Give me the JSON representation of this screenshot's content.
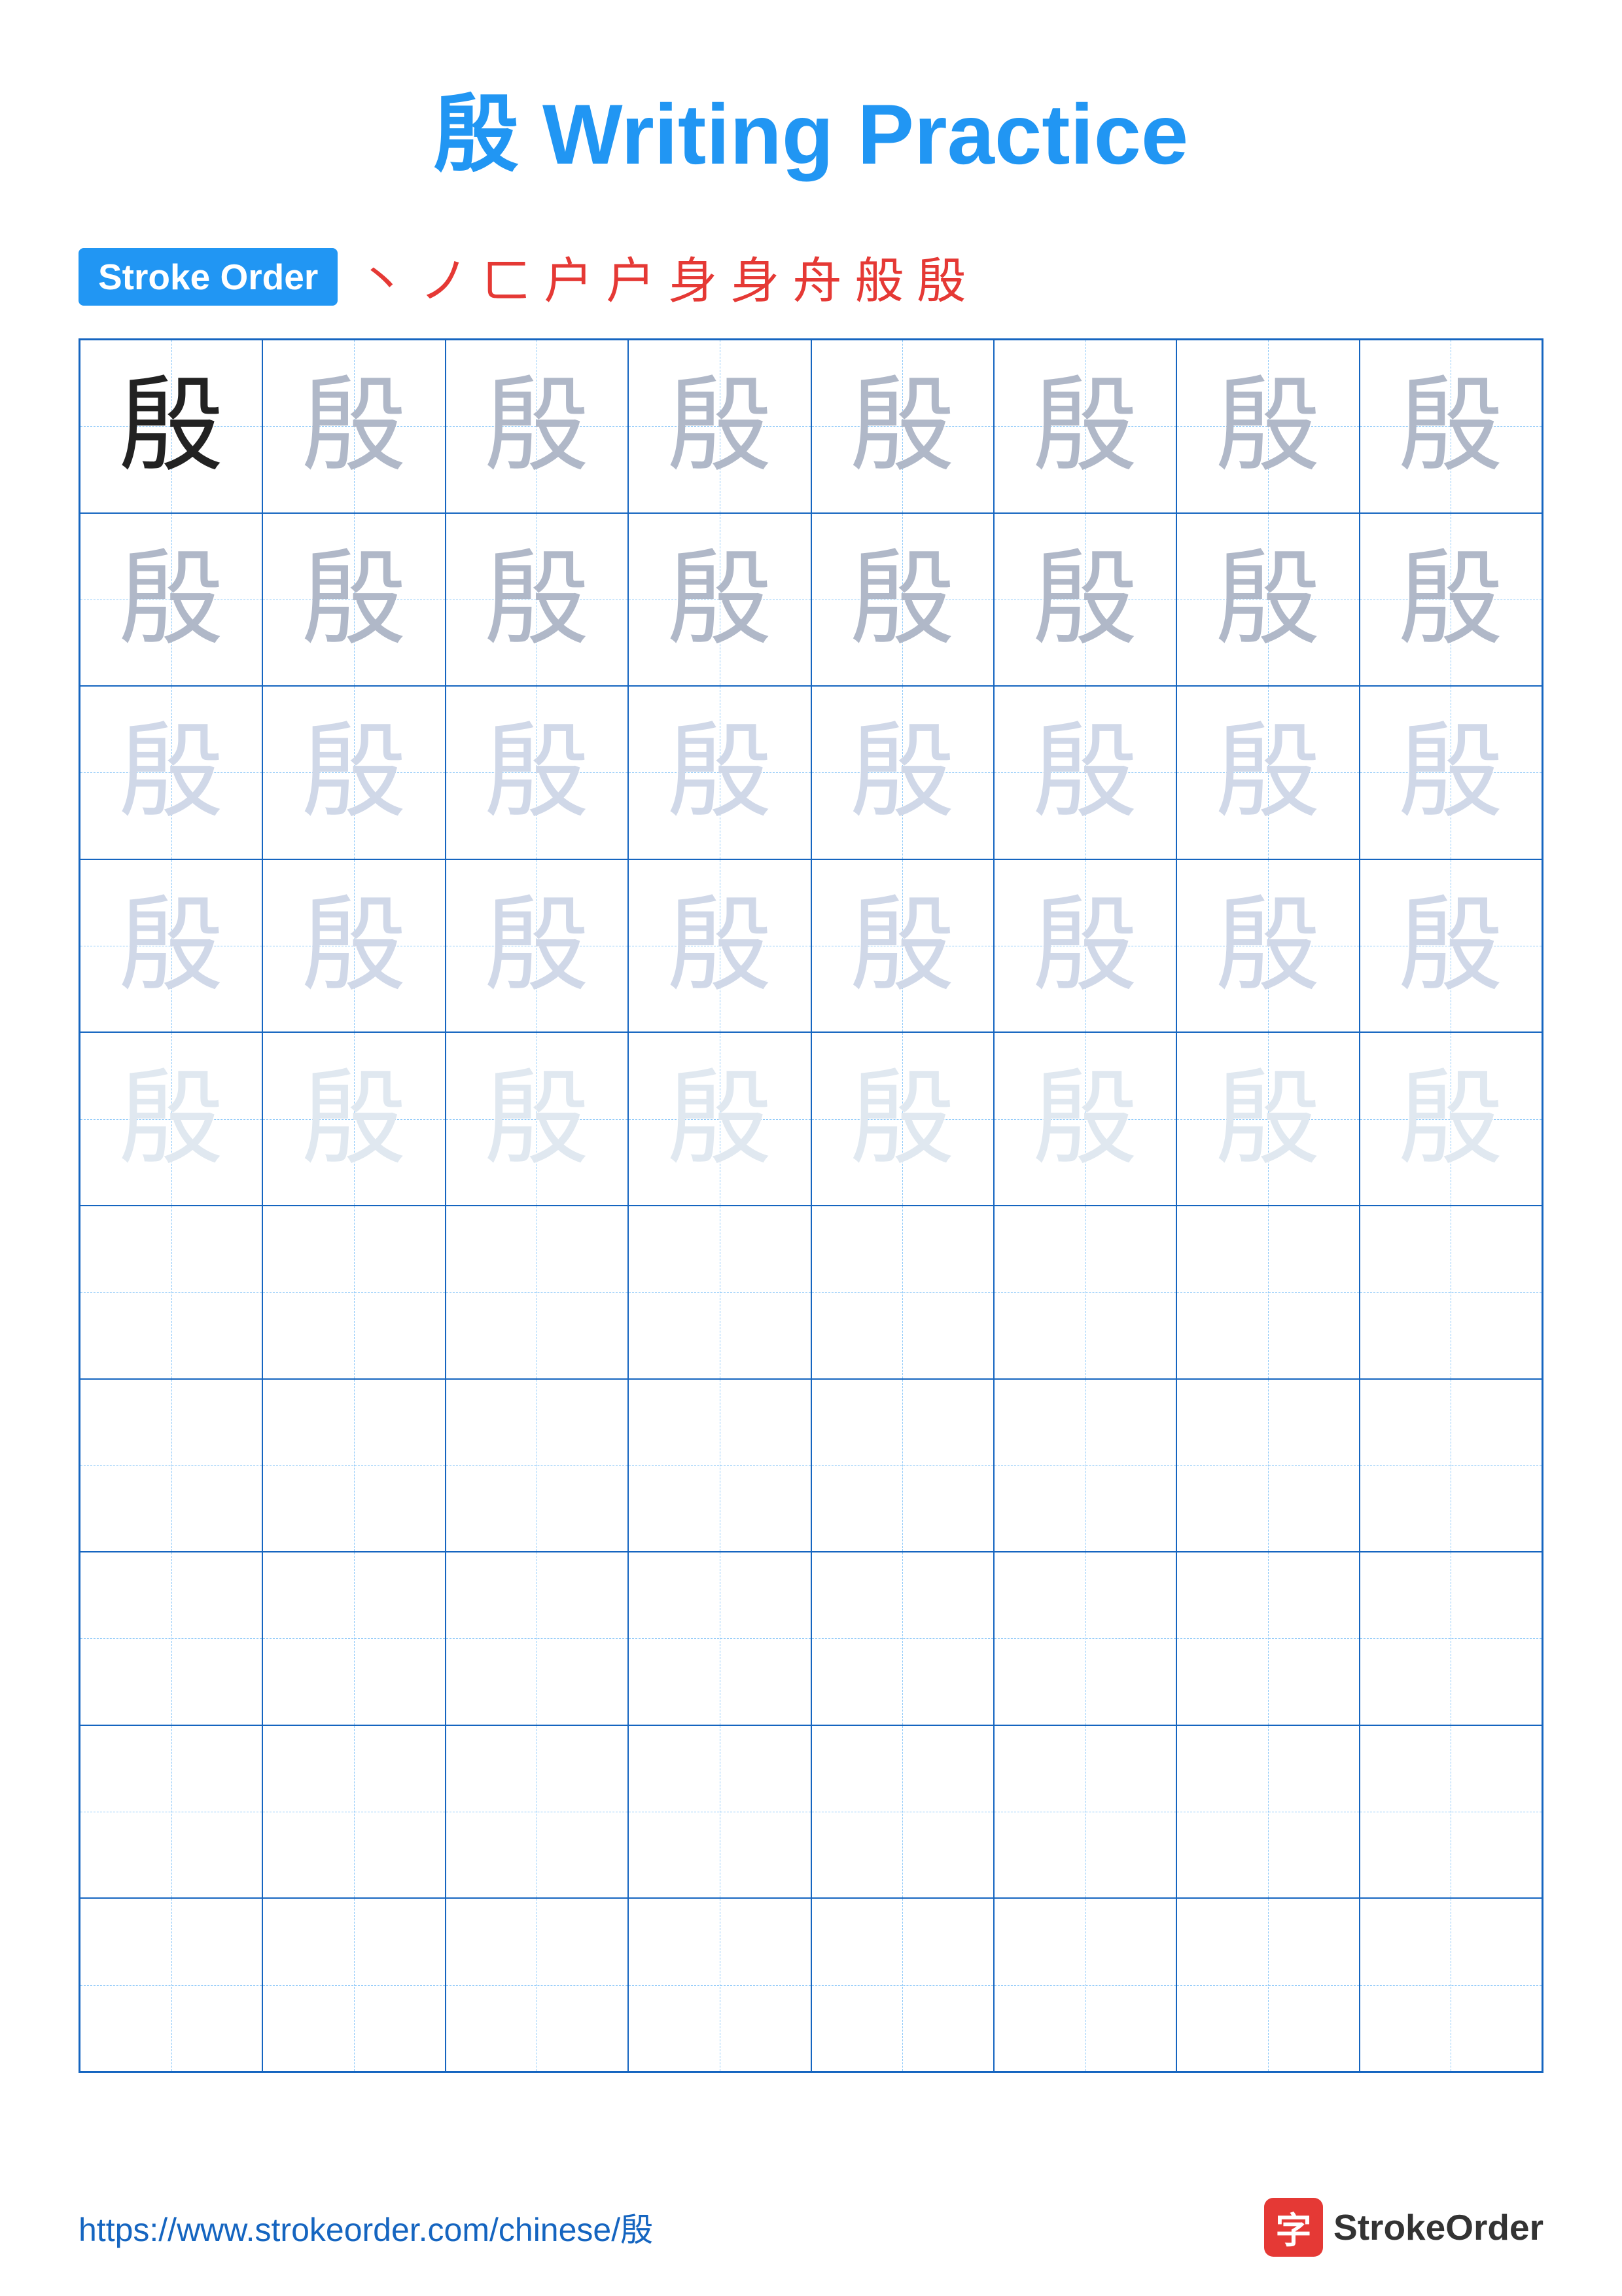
{
  "title": "殷 Writing Practice",
  "stroke_order_badge": "Stroke Order",
  "stroke_sequence": [
    "丶",
    "ノ",
    "ㄈ",
    "户",
    "户",
    "身",
    "身",
    "舟",
    "般",
    "殷"
  ],
  "character": "殷",
  "grid": {
    "cols": 8,
    "rows": 10,
    "cells": [
      {
        "row": 0,
        "col": 0,
        "shade": "dark"
      },
      {
        "row": 0,
        "col": 1,
        "shade": "medium"
      },
      {
        "row": 0,
        "col": 2,
        "shade": "medium"
      },
      {
        "row": 0,
        "col": 3,
        "shade": "medium"
      },
      {
        "row": 0,
        "col": 4,
        "shade": "medium"
      },
      {
        "row": 0,
        "col": 5,
        "shade": "medium"
      },
      {
        "row": 0,
        "col": 6,
        "shade": "medium"
      },
      {
        "row": 0,
        "col": 7,
        "shade": "medium"
      },
      {
        "row": 1,
        "col": 0,
        "shade": "medium"
      },
      {
        "row": 1,
        "col": 1,
        "shade": "medium"
      },
      {
        "row": 1,
        "col": 2,
        "shade": "medium"
      },
      {
        "row": 1,
        "col": 3,
        "shade": "medium"
      },
      {
        "row": 1,
        "col": 4,
        "shade": "medium"
      },
      {
        "row": 1,
        "col": 5,
        "shade": "medium"
      },
      {
        "row": 1,
        "col": 6,
        "shade": "medium"
      },
      {
        "row": 1,
        "col": 7,
        "shade": "medium"
      },
      {
        "row": 2,
        "col": 0,
        "shade": "light"
      },
      {
        "row": 2,
        "col": 1,
        "shade": "light"
      },
      {
        "row": 2,
        "col": 2,
        "shade": "light"
      },
      {
        "row": 2,
        "col": 3,
        "shade": "light"
      },
      {
        "row": 2,
        "col": 4,
        "shade": "light"
      },
      {
        "row": 2,
        "col": 5,
        "shade": "light"
      },
      {
        "row": 2,
        "col": 6,
        "shade": "light"
      },
      {
        "row": 2,
        "col": 7,
        "shade": "light"
      },
      {
        "row": 3,
        "col": 0,
        "shade": "light"
      },
      {
        "row": 3,
        "col": 1,
        "shade": "light"
      },
      {
        "row": 3,
        "col": 2,
        "shade": "light"
      },
      {
        "row": 3,
        "col": 3,
        "shade": "light"
      },
      {
        "row": 3,
        "col": 4,
        "shade": "light"
      },
      {
        "row": 3,
        "col": 5,
        "shade": "light"
      },
      {
        "row": 3,
        "col": 6,
        "shade": "light"
      },
      {
        "row": 3,
        "col": 7,
        "shade": "light"
      },
      {
        "row": 4,
        "col": 0,
        "shade": "very-light"
      },
      {
        "row": 4,
        "col": 1,
        "shade": "very-light"
      },
      {
        "row": 4,
        "col": 2,
        "shade": "very-light"
      },
      {
        "row": 4,
        "col": 3,
        "shade": "very-light"
      },
      {
        "row": 4,
        "col": 4,
        "shade": "very-light"
      },
      {
        "row": 4,
        "col": 5,
        "shade": "very-light"
      },
      {
        "row": 4,
        "col": 6,
        "shade": "very-light"
      },
      {
        "row": 4,
        "col": 7,
        "shade": "very-light"
      },
      {
        "row": 5,
        "col": 0,
        "shade": "empty"
      },
      {
        "row": 5,
        "col": 1,
        "shade": "empty"
      },
      {
        "row": 5,
        "col": 2,
        "shade": "empty"
      },
      {
        "row": 5,
        "col": 3,
        "shade": "empty"
      },
      {
        "row": 5,
        "col": 4,
        "shade": "empty"
      },
      {
        "row": 5,
        "col": 5,
        "shade": "empty"
      },
      {
        "row": 5,
        "col": 6,
        "shade": "empty"
      },
      {
        "row": 5,
        "col": 7,
        "shade": "empty"
      },
      {
        "row": 6,
        "col": 0,
        "shade": "empty"
      },
      {
        "row": 6,
        "col": 1,
        "shade": "empty"
      },
      {
        "row": 6,
        "col": 2,
        "shade": "empty"
      },
      {
        "row": 6,
        "col": 3,
        "shade": "empty"
      },
      {
        "row": 6,
        "col": 4,
        "shade": "empty"
      },
      {
        "row": 6,
        "col": 5,
        "shade": "empty"
      },
      {
        "row": 6,
        "col": 6,
        "shade": "empty"
      },
      {
        "row": 6,
        "col": 7,
        "shade": "empty"
      },
      {
        "row": 7,
        "col": 0,
        "shade": "empty"
      },
      {
        "row": 7,
        "col": 1,
        "shade": "empty"
      },
      {
        "row": 7,
        "col": 2,
        "shade": "empty"
      },
      {
        "row": 7,
        "col": 3,
        "shade": "empty"
      },
      {
        "row": 7,
        "col": 4,
        "shade": "empty"
      },
      {
        "row": 7,
        "col": 5,
        "shade": "empty"
      },
      {
        "row": 7,
        "col": 6,
        "shade": "empty"
      },
      {
        "row": 7,
        "col": 7,
        "shade": "empty"
      },
      {
        "row": 8,
        "col": 0,
        "shade": "empty"
      },
      {
        "row": 8,
        "col": 1,
        "shade": "empty"
      },
      {
        "row": 8,
        "col": 2,
        "shade": "empty"
      },
      {
        "row": 8,
        "col": 3,
        "shade": "empty"
      },
      {
        "row": 8,
        "col": 4,
        "shade": "empty"
      },
      {
        "row": 8,
        "col": 5,
        "shade": "empty"
      },
      {
        "row": 8,
        "col": 6,
        "shade": "empty"
      },
      {
        "row": 8,
        "col": 7,
        "shade": "empty"
      },
      {
        "row": 9,
        "col": 0,
        "shade": "empty"
      },
      {
        "row": 9,
        "col": 1,
        "shade": "empty"
      },
      {
        "row": 9,
        "col": 2,
        "shade": "empty"
      },
      {
        "row": 9,
        "col": 3,
        "shade": "empty"
      },
      {
        "row": 9,
        "col": 4,
        "shade": "empty"
      },
      {
        "row": 9,
        "col": 5,
        "shade": "empty"
      },
      {
        "row": 9,
        "col": 6,
        "shade": "empty"
      },
      {
        "row": 9,
        "col": 7,
        "shade": "empty"
      }
    ]
  },
  "footer": {
    "url": "https://www.strokeorder.com/chinese/殷",
    "logo_char": "字",
    "logo_text": "StrokeOrder"
  }
}
